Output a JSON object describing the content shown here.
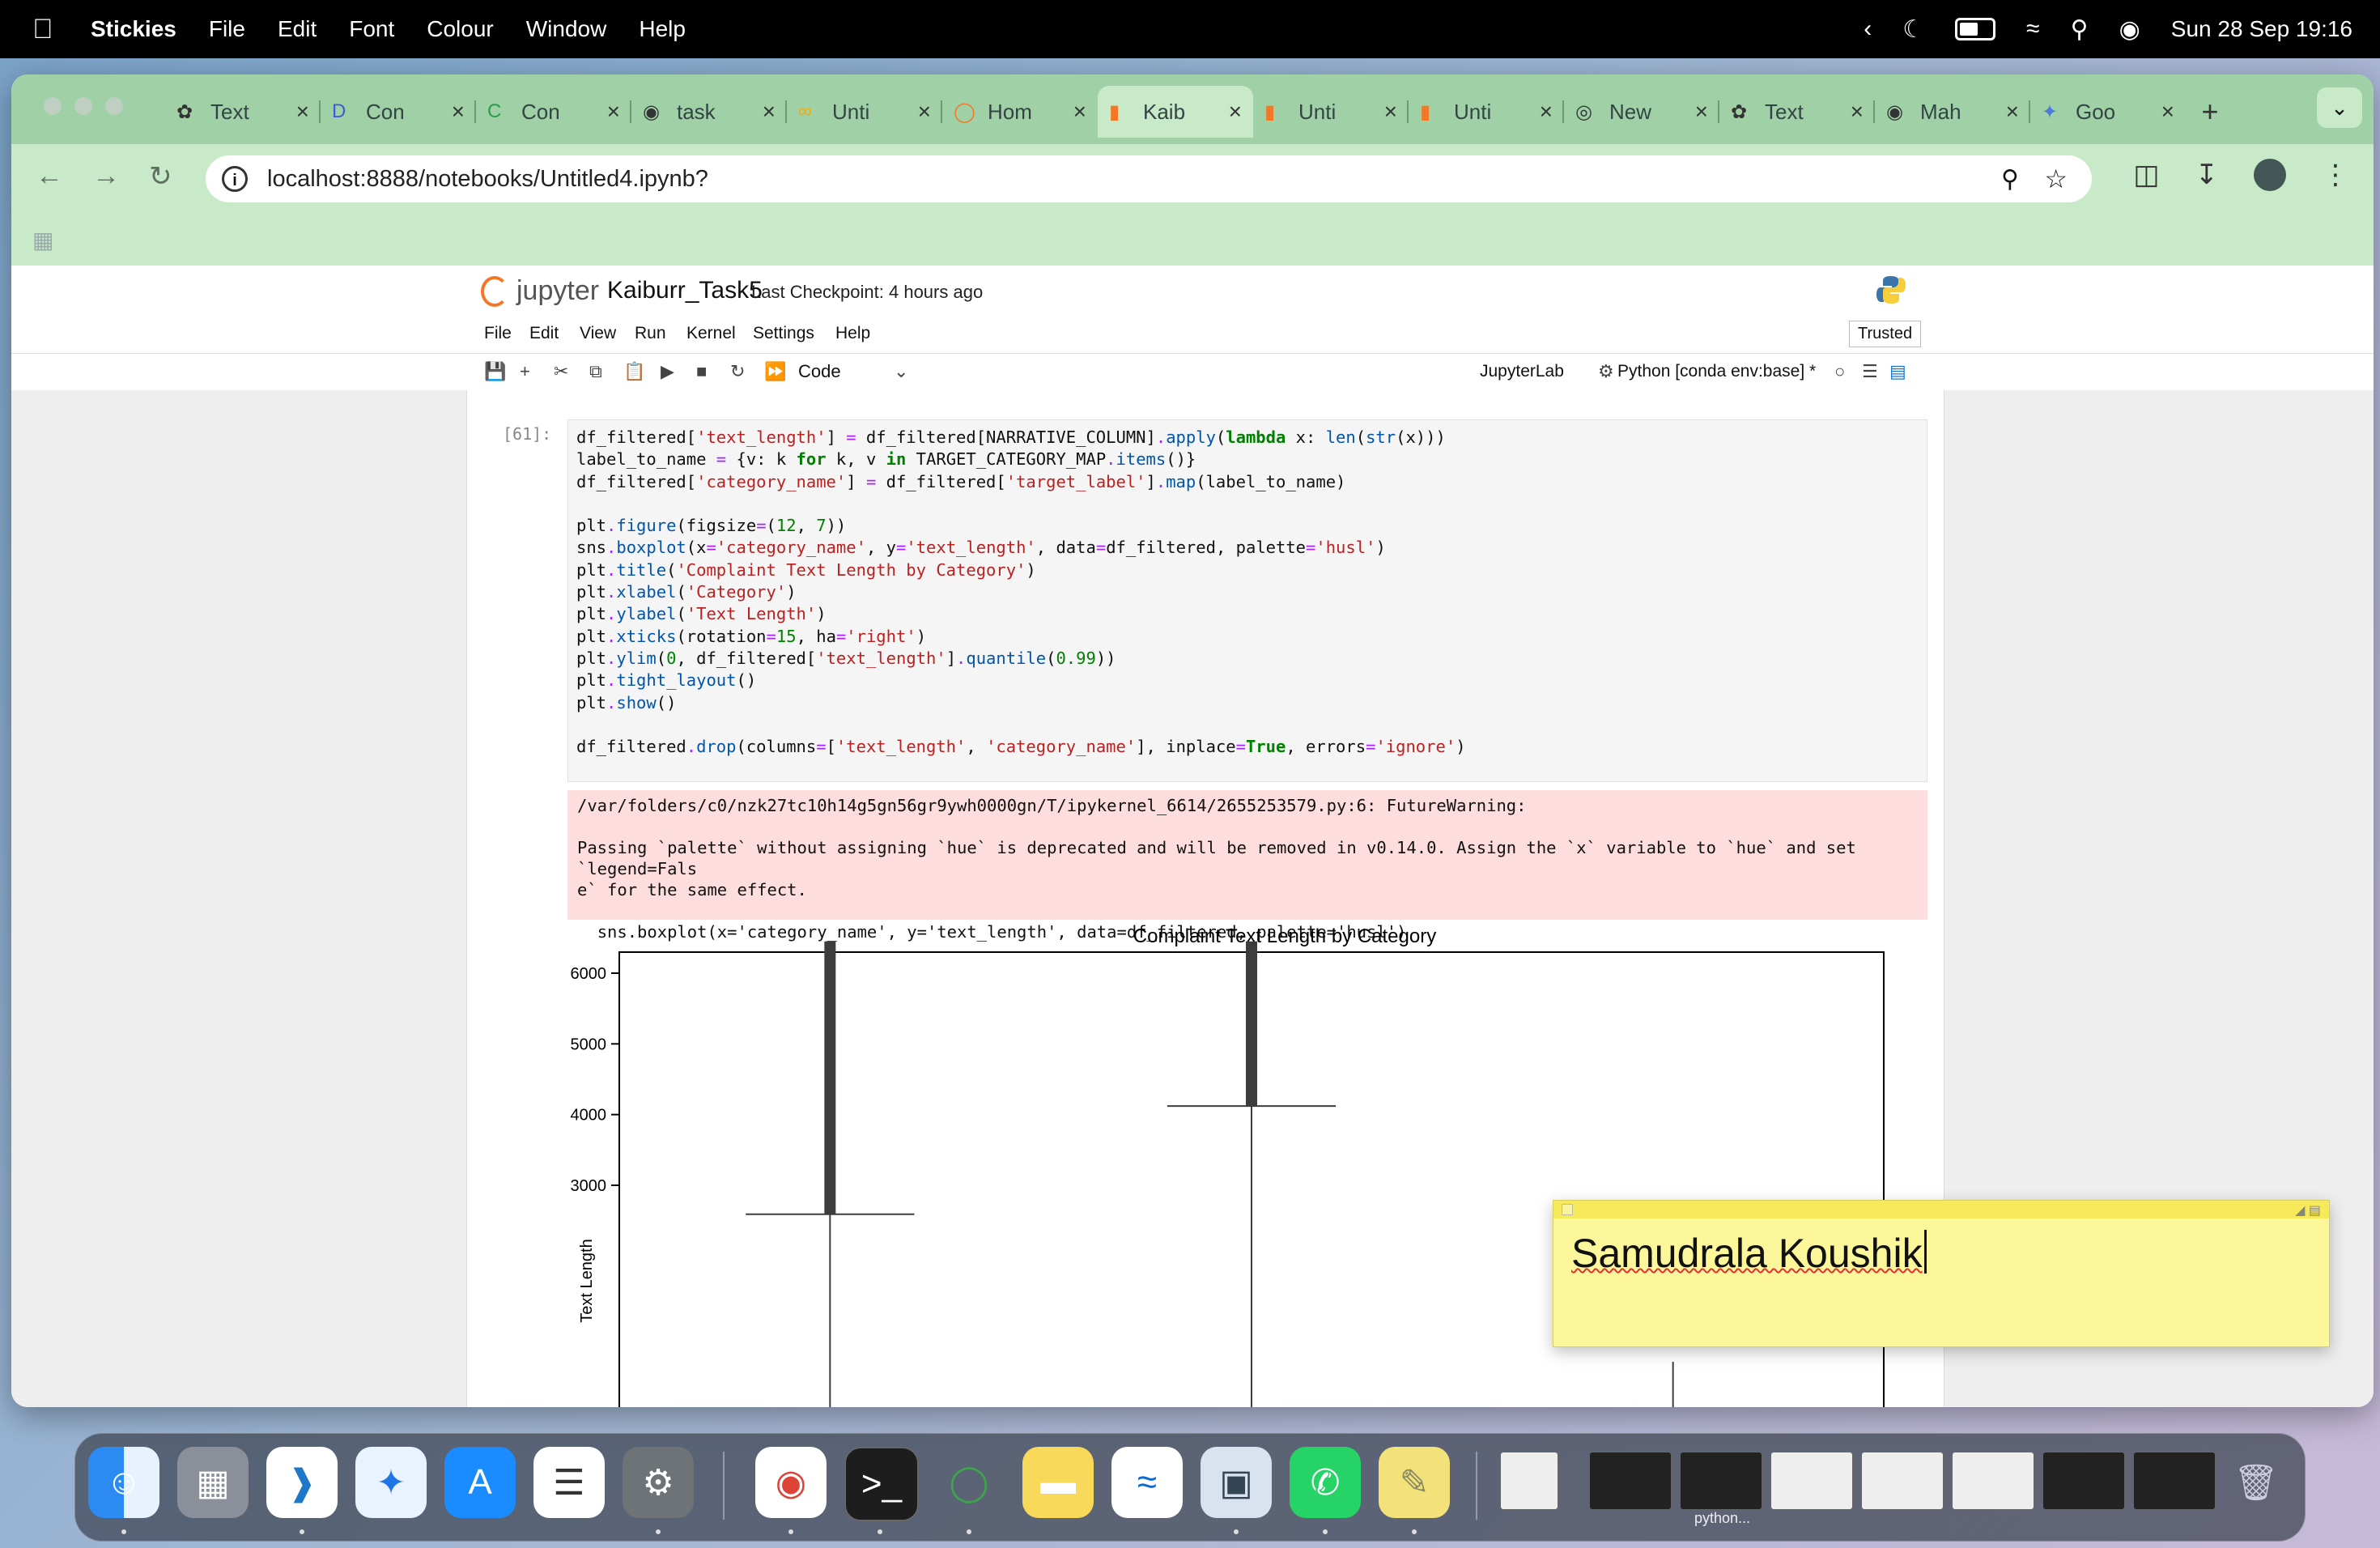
{
  "menubar": {
    "app_name": "Stickies",
    "items": [
      "File",
      "Edit",
      "Font",
      "Colour",
      "Window",
      "Help"
    ],
    "datetime": "Sun 28 Sep  19:16"
  },
  "browser": {
    "tabs": [
      {
        "label": "Text",
        "icon": "chatgpt-icon"
      },
      {
        "label": "Con",
        "icon": "deepseek-icon"
      },
      {
        "label": "Con",
        "icon": "copilot-icon"
      },
      {
        "label": "task",
        "icon": "github-icon"
      },
      {
        "label": "Unti",
        "icon": "colab-icon"
      },
      {
        "label": "Hom",
        "icon": "jupyter-icon"
      },
      {
        "label": "Kaib",
        "icon": "jupyter-icon",
        "active": true
      },
      {
        "label": "Unti",
        "icon": "jupyter-icon"
      },
      {
        "label": "Unti",
        "icon": "jupyter-icon"
      },
      {
        "label": "New",
        "icon": "chrome-icon"
      },
      {
        "label": "Text",
        "icon": "chatgpt-icon"
      },
      {
        "label": "Mah",
        "icon": "github-icon"
      },
      {
        "label": "Goo",
        "icon": "gemini-icon"
      }
    ],
    "url": "localhost:8888/notebooks/Untitled4.ipynb?"
  },
  "jupyter": {
    "logo_text": "jupyter",
    "notebook_name": "Kaiburr_Task5",
    "checkpoint": "Last Checkpoint: 4 hours ago",
    "menu": [
      "File",
      "Edit",
      "View",
      "Run",
      "Kernel",
      "Settings",
      "Help"
    ],
    "trusted": "Trusted",
    "cell_type": "Code",
    "jupyterlab_link": "JupyterLab",
    "kernel": "Python [conda env:base] *",
    "prompt": "[61]:",
    "stderr_lines": [
      "/var/folders/c0/nzk27tc10h14g5gn56gr9ywh0000gn/T/ipykernel_6614/2655253579.py:6: FutureWarning:",
      "",
      "Passing `palette` without assigning `hue` is deprecated and will be removed in v0.14.0. Assign the `x` variable to `hue` and set `legend=Fals",
      "e` for the same effect.",
      "",
      "  sns.boxplot(x='category_name', y='text_length', data=df_filtered, palette='husl')"
    ]
  },
  "chart_data": {
    "type": "box",
    "title": "Complaint Text Length by Category",
    "ylabel": "Text Length",
    "xlabel": "",
    "y_ticks": [
      3000,
      4000,
      5000,
      6000
    ],
    "ylim_visible": [
      2100,
      6450
    ],
    "boxes": [
      {
        "whisker_upper": 2590,
        "outliers_from": 2590,
        "outliers_to": 6450
      },
      {
        "whisker_upper": 4120,
        "outliers_from": 4120,
        "outliers_to": 6450
      },
      {
        "whisker_upper": null,
        "outliers_from": null,
        "outliers_to": null
      }
    ],
    "colors": {
      "axis": "#000000",
      "box_line": "#3d3d3d"
    }
  },
  "sticky": {
    "text": "Samudrala Koushik"
  },
  "dock": {
    "apps": [
      "finder-icon",
      "launchpad-icon",
      "vscode-icon",
      "safari-icon",
      "app-store-icon",
      "reminders-icon",
      "system-settings-icon",
      "chrome-icon",
      "terminal-icon",
      "anaconda-icon",
      "notes-icon",
      "freeform-icon",
      "preview-icon",
      "whatsapp-icon",
      "stickies-icon"
    ],
    "thumb_label": "python..."
  }
}
